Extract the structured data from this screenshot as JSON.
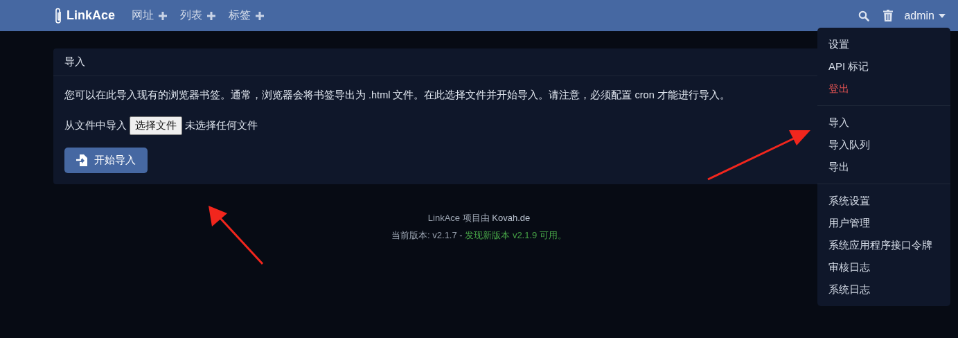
{
  "navbar": {
    "brand": "LinkAce",
    "items": [
      {
        "label": "网址"
      },
      {
        "label": "列表"
      },
      {
        "label": "标签"
      }
    ],
    "user": "admin"
  },
  "user_menu": {
    "groups": [
      {
        "items": [
          {
            "label": "设置",
            "kind": "normal"
          },
          {
            "label": "API 标记",
            "kind": "normal"
          },
          {
            "label": "登出",
            "kind": "danger"
          }
        ]
      },
      {
        "items": [
          {
            "label": "导入",
            "kind": "normal"
          },
          {
            "label": "导入队列",
            "kind": "normal"
          },
          {
            "label": "导出",
            "kind": "normal"
          }
        ]
      },
      {
        "items": [
          {
            "label": "系统设置",
            "kind": "normal"
          },
          {
            "label": "用户管理",
            "kind": "normal"
          },
          {
            "label": "系统应用程序接口令牌",
            "kind": "normal"
          },
          {
            "label": "审核日志",
            "kind": "normal"
          },
          {
            "label": "系统日志",
            "kind": "normal"
          }
        ]
      }
    ]
  },
  "card": {
    "title": "导入",
    "description": "您可以在此导入现有的浏览器书签。通常，浏览器会将书签导出为 .html 文件。在此选择文件并开始导入。请注意，必须配置 cron 才能进行导入。",
    "file_label": "从文件中导入",
    "file_button": "选择文件",
    "file_status": "未选择任何文件",
    "submit": "开始导入"
  },
  "footer": {
    "credit_prefix": "LinkAce 项目由",
    "credit_link": "Kovah.de",
    "version": "当前版本: v2.1.7 -",
    "update_link": "发现新版本 v2.1.9 可用。"
  }
}
